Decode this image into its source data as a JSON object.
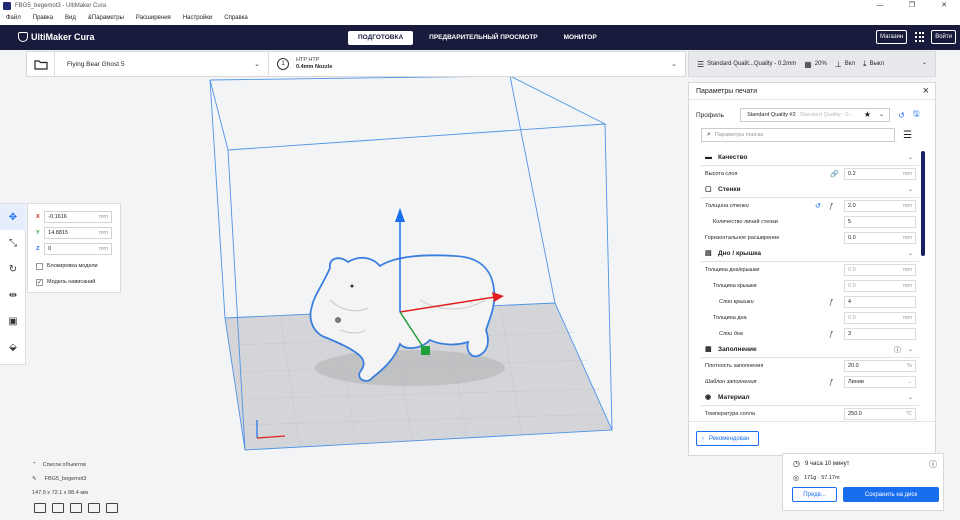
{
  "window": {
    "title": "FBG5_begemot3 - UltiMaker Cura",
    "controls": [
      "—",
      "❐",
      "✕"
    ]
  },
  "menu": [
    "Файл",
    "Правка",
    "Вид",
    "&Параметры",
    "Расширения",
    "Настройки",
    "Справка"
  ],
  "header": {
    "logo": "UltiMaker Cura",
    "tabs": [
      "ПОДГОТОВКА",
      "ПРЕДВАРИТЕЛЬНЫЙ ПРОСМОТР",
      "МОНИТОР"
    ],
    "marketplace": "Магазин",
    "signin": "Войти"
  },
  "machine": {
    "printer": "Flying Bear Ghost 5",
    "material_line1": "HTP HTP",
    "material_line2": "0.4mm Nozzle",
    "nozzle_num": "1"
  },
  "print_summary": {
    "profile": "Standard Qualit...Quality - 0.2mm",
    "infill": "20%",
    "support": "Вкл",
    "adhesion": "Выкл"
  },
  "move_tool": {
    "x": "-0.1616",
    "y": "14.8815",
    "z": "0",
    "unit": "mm",
    "lock_model": "Блокировка модели",
    "drop_down": "Модель нависаний",
    "drop_down_checked": "✓"
  },
  "settings_panel": {
    "title": "Параметры печати",
    "profile_label": "Профиль",
    "profile_value": "Standard Quality #2",
    "profile_sub": "Standard Quality - 0...",
    "search_placeholder": "Параметры поиска",
    "categories": {
      "quality": "Качество",
      "walls": "Стенки",
      "topbottom": "Дно / крышка",
      "infill": "Заполнение",
      "material": "Материал"
    },
    "settings": {
      "layer_height": {
        "label": "Высота слоя",
        "value": "0.2",
        "unit": "mm"
      },
      "wall_thickness": {
        "label": "Толщина стенки",
        "value": "2.0",
        "unit": "mm"
      },
      "wall_line_count": {
        "label": "Количество линий стенки",
        "value": "5"
      },
      "horizontal_expansion": {
        "label": "Горизонтальное расширение",
        "value": "0.0",
        "unit": "mm"
      },
      "topbottom_thickness": {
        "label": "Толщина дна/крышки",
        "value": "0.9",
        "unit": "mm"
      },
      "top_thickness": {
        "label": "Толщина крышки",
        "value": "0.9",
        "unit": "mm"
      },
      "top_layers": {
        "label": "Слои крышки",
        "value": "4"
      },
      "bottom_thickness": {
        "label": "Толщина дна",
        "value": "0.9",
        "unit": "mm"
      },
      "bottom_layers": {
        "label": "Слои дна",
        "value": "3"
      },
      "infill_density": {
        "label": "Плотность заполнения",
        "value": "20.0",
        "unit": "%"
      },
      "infill_pattern": {
        "label": "Шаблон заполнения",
        "value": "Линии"
      },
      "nozzle_temp": {
        "label": "Температура сопла",
        "value": "250.0",
        "unit": "°C"
      }
    },
    "recommended_button": "Рекомендован"
  },
  "objects": {
    "list_label": "Список объектов",
    "item": "FBG5_begemot3",
    "dimensions": "147.9 x 72.1 x 88.4 мм"
  },
  "action": {
    "time": "9 часа 10 минут",
    "material": "171g · 57.17m",
    "preview_button": "Предв...",
    "save_button": "Сохранить на диск"
  },
  "colors": {
    "header": "#181b3b",
    "accent": "#196ef0",
    "axis_x": "#e02020",
    "axis_y": "#1f9e3a",
    "axis_z": "#196ef0"
  }
}
